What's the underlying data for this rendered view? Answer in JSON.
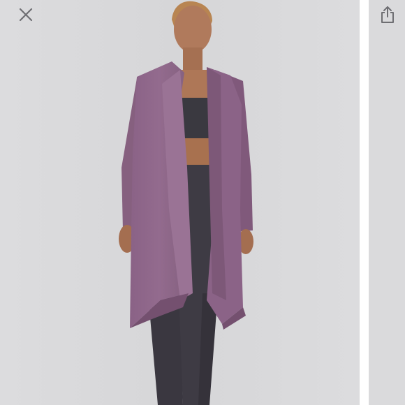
{
  "viewer": {
    "close_icon": "close-icon",
    "share_icon": "share-icon"
  },
  "photo": {
    "subject": "model-wearing-cardigan",
    "colors": {
      "background": "#d9d9db",
      "cardigan": "#8e6689",
      "cardigan_shadow": "#74506f",
      "bra": "#3a3940",
      "leggings": "#3e3b44",
      "skin": "#b07a5c",
      "hair": "#b88552"
    }
  }
}
